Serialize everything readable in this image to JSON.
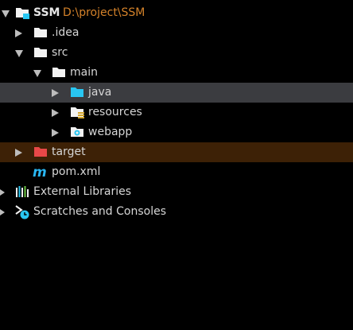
{
  "project_tree": {
    "root": {
      "label": "SSM",
      "path": "D:\\project\\SSM",
      "icon": "module-folder-icon"
    },
    "items": [
      {
        "label": ".idea",
        "icon": "folder-icon"
      },
      {
        "label": "src",
        "icon": "folder-icon"
      },
      {
        "label": "main",
        "icon": "folder-icon"
      },
      {
        "label": "java",
        "icon": "source-folder-icon"
      },
      {
        "label": "resources",
        "icon": "resources-folder-icon"
      },
      {
        "label": "webapp",
        "icon": "web-folder-icon"
      },
      {
        "label": "target",
        "icon": "excluded-folder-icon"
      },
      {
        "label": "pom.xml",
        "icon": "maven-file-icon"
      },
      {
        "label": "External Libraries",
        "icon": "libraries-icon"
      },
      {
        "label": "Scratches and Consoles",
        "icon": "scratches-icon"
      }
    ]
  },
  "colors": {
    "background": "#000000",
    "text": "#d6d6d6",
    "path": "#d4822a",
    "selection": "#3b3c40",
    "excluded_highlight": "#3d2106",
    "source_folder": "#29c6f2",
    "excluded_folder": "#e84848",
    "maven_m": "#29b6f2"
  }
}
